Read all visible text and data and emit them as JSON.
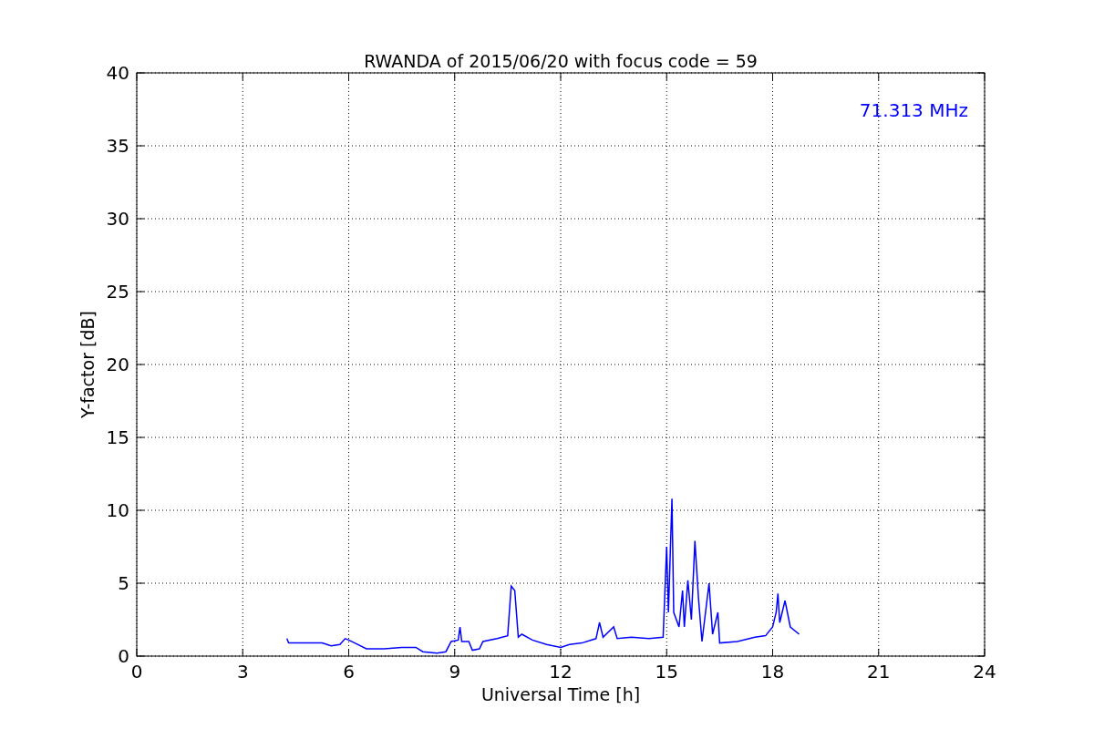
{
  "chart": {
    "chart_data": {
      "type": "line",
      "title": "RWANDA of 2015/06/20 with focus code = 59",
      "xlabel": "Universal Time [h]",
      "ylabel": "Y-factor [dB]",
      "x": [
        4.25,
        4.3,
        4.5,
        5,
        5.25,
        5.5,
        5.75,
        5.9,
        6.0,
        6.25,
        6.5,
        7,
        7.5,
        7.9,
        8.1,
        8.5,
        8.75,
        8.9,
        9.1,
        9.15,
        9.2,
        9.4,
        9.5,
        9.7,
        9.8,
        10.2,
        10.5,
        10.6,
        10.7,
        10.8,
        10.9,
        11.2,
        11.6,
        12,
        12.25,
        12.6,
        13,
        13.1,
        13.2,
        13.5,
        13.6,
        14,
        14.5,
        14.9,
        15.0,
        15.05,
        15.15,
        15.2,
        15.35,
        15.45,
        15.5,
        15.6,
        15.7,
        15.8,
        15.9,
        16.0,
        16.2,
        16.3,
        16.45,
        16.5,
        17,
        17.5,
        17.8,
        18,
        18.1,
        18.15,
        18.2,
        18.35,
        18.5,
        18.75
      ],
      "series": [
        {
          "name": "71.313 MHz",
          "color": "#0000ff",
          "values": [
            1.2,
            0.9,
            0.9,
            0.9,
            0.9,
            0.7,
            0.8,
            1.2,
            1.1,
            0.8,
            0.5,
            0.5,
            0.6,
            0.6,
            0.3,
            0.2,
            0.3,
            1.0,
            1.1,
            2.0,
            1.0,
            1.0,
            0.4,
            0.5,
            1.0,
            1.2,
            1.4,
            4.8,
            4.5,
            1.3,
            1.5,
            1.1,
            0.8,
            0.6,
            0.8,
            0.9,
            1.2,
            2.3,
            1.3,
            2.0,
            1.2,
            1.3,
            1.2,
            1.3,
            7.5,
            3.0,
            10.8,
            3.0,
            2.0,
            4.5,
            2.0,
            5.2,
            2.5,
            7.9,
            4.0,
            1.0,
            5.0,
            1.5,
            3.0,
            0.9,
            1.0,
            1.3,
            1.4,
            2.0,
            3.0,
            4.3,
            2.3,
            3.8,
            2.0,
            1.5
          ]
        }
      ],
      "grid": true,
      "xlim": [
        0,
        24
      ],
      "ylim": [
        0,
        40
      ],
      "xticks": [
        0,
        3,
        6,
        9,
        12,
        15,
        18,
        21,
        24
      ],
      "yticks": [
        0,
        5,
        10,
        15,
        20,
        25,
        30,
        35,
        40
      ]
    }
  }
}
